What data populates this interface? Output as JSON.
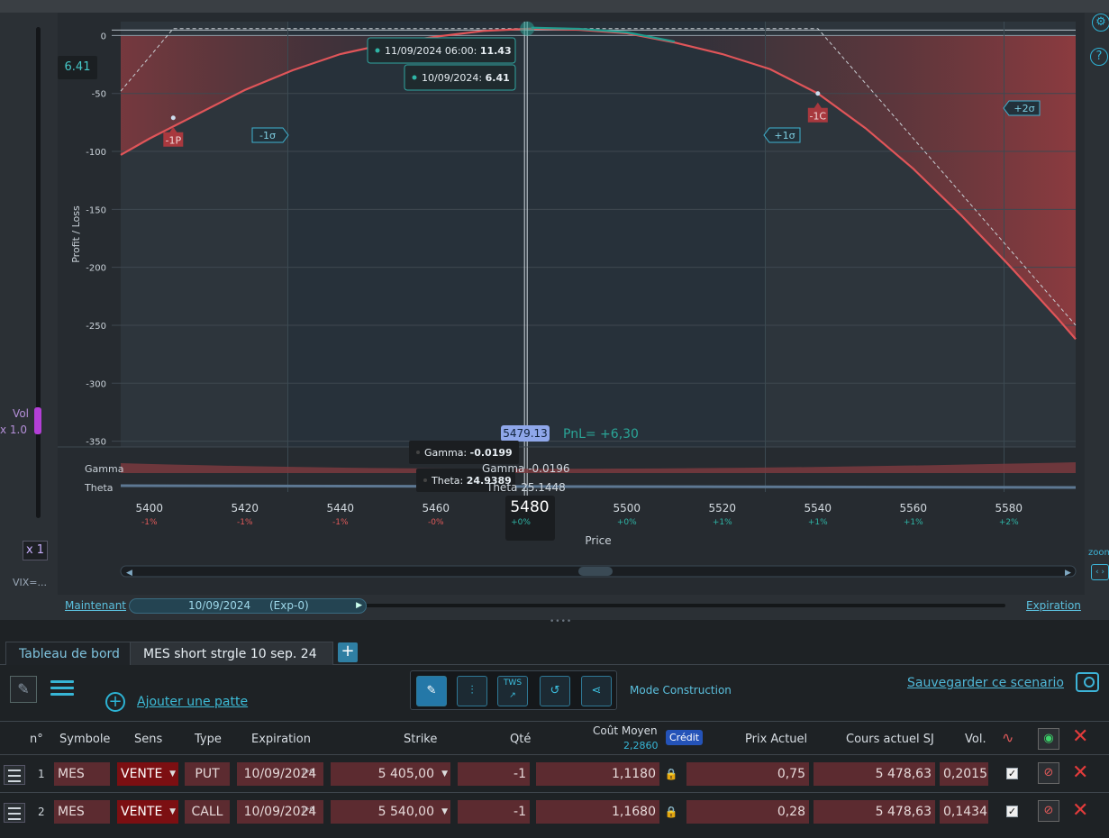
{
  "left_panel": {
    "value_badge": "6.41",
    "vol_label": "Vol",
    "vol_multiplier": "x 1.0",
    "x1_button": "x 1",
    "vix_label": "VIX=..."
  },
  "chart_data": {
    "type": "line",
    "xlabel": "Price",
    "ylabel": "Profit / Loss",
    "xlim": [
      5394,
      5594
    ],
    "ylim": [
      -355,
      12
    ],
    "x_ticks": [
      {
        "v": 5400,
        "pct": "-1%"
      },
      {
        "v": 5420,
        "pct": "-1%"
      },
      {
        "v": 5440,
        "pct": "-1%"
      },
      {
        "v": 5460,
        "pct": "-0%"
      },
      {
        "v": 5480,
        "pct": "+0%"
      },
      {
        "v": 5500,
        "pct": "+0%"
      },
      {
        "v": 5520,
        "pct": "+1%"
      },
      {
        "v": 5540,
        "pct": "+1%"
      },
      {
        "v": 5560,
        "pct": "+1%"
      },
      {
        "v": 5580,
        "pct": "+2%"
      }
    ],
    "y_ticks": [
      0,
      -50,
      -100,
      -150,
      -200,
      -250,
      -300,
      -350
    ],
    "series": [
      {
        "name": "10/09/2024",
        "x": [
          5394,
          5400,
          5410,
          5420,
          5430,
          5440,
          5450,
          5460,
          5470,
          5480,
          5490,
          5500,
          5510,
          5520,
          5530,
          5540,
          5550,
          5560,
          5570,
          5580,
          5590,
          5594
        ],
        "y": [
          -103,
          -89,
          -68,
          -47,
          -30,
          -16,
          -7,
          -1,
          4,
          6,
          5,
          2,
          -6,
          -16,
          -29,
          -50,
          -80,
          -115,
          -155,
          -198,
          -243,
          -262
        ]
      },
      {
        "name": "Expiration",
        "x": [
          5394,
          5405,
          5540,
          5594
        ],
        "y": [
          -48,
          6,
          6,
          -250
        ]
      }
    ],
    "sigma_lines": [
      {
        "label": "-1σ",
        "x": 5429
      },
      {
        "label": "+1σ",
        "x": 5529
      },
      {
        "label": "+2σ",
        "x": 5579
      }
    ],
    "legs": [
      {
        "label": "-1P",
        "x": 5405,
        "y": -71
      },
      {
        "label": "-1C",
        "x": 5540,
        "y": -50
      }
    ],
    "current_price": 5479.13,
    "cursor_price": "5480",
    "cursor_price_label": "5479.13",
    "cursor_pct": "+0%",
    "pnl_label": "PnL= +6,30",
    "tooltips": [
      {
        "date": "11/09/2024 06:00",
        "value": "11.43"
      },
      {
        "date": "10/09/2024",
        "value": "6.41"
      }
    ],
    "greeks": {
      "gamma_label": "Gamma",
      "theta_label": "Theta",
      "gamma_tip_name": "Gamma",
      "gamma_tip_value": "-0.0199",
      "theta_tip_name": "Theta",
      "theta_tip_value": "24.9389",
      "gamma_cursor": "Gamma -0.0196",
      "theta_cursor": "Theta 25.1448"
    }
  },
  "timeline": {
    "now_label": "Maintenant",
    "date": "10/09/2024",
    "exp": "(Exp-0)",
    "expiry_label": "Expiration"
  },
  "tabs": [
    {
      "label": "Tableau de bord"
    },
    {
      "label": "MES short strgle 10 sep. 24"
    }
  ],
  "tab_add": "+",
  "toolbar": {
    "add_leg": "Ajouter une patte",
    "mode_label": "Mode Construction",
    "save_link": "Sauvegarder ce scenario",
    "tws_label": "TWS"
  },
  "table": {
    "headers": {
      "n": "n°",
      "symbole": "Symbole",
      "sens": "Sens",
      "type": "Type",
      "expiration": "Expiration",
      "strike": "Strike",
      "qte": "Qté",
      "cout": "Coût Moyen",
      "cout_sub": "2,2860",
      "credit": "Crédit",
      "prix": "Prix Actuel",
      "cours": "Cours actuel SJ",
      "vol": "Vol."
    },
    "rows": [
      {
        "n": "1",
        "symbole": "MES",
        "sens": "VENTE",
        "type": "PUT",
        "j": "J+0",
        "expiration": "10/09/2024",
        "strike": "5 405,00",
        "qte": "-1",
        "cout": "1,1180",
        "prix": "0,75",
        "cours": "5 478,63",
        "vol": "0,2015",
        "check": "✓"
      },
      {
        "n": "2",
        "symbole": "MES",
        "sens": "VENTE",
        "type": "CALL",
        "j": "J+0",
        "expiration": "10/09/2024",
        "strike": "5 540,00",
        "qte": "-1",
        "cout": "1,1680",
        "prix": "0,28",
        "cours": "5 478,63",
        "vol": "0,1434",
        "check": "✓"
      }
    ]
  }
}
